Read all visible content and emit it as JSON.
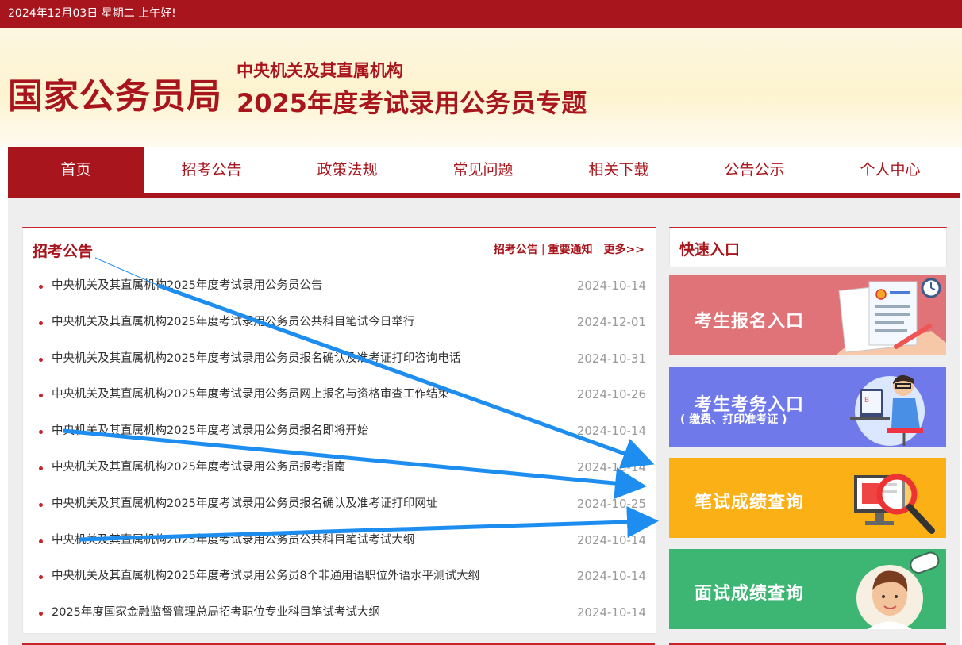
{
  "topbar": {
    "date_greeting": "2024年12月03日  星期二  上午好!"
  },
  "header": {
    "site_name": "国家公务员局",
    "subtitle_line1": "中央机关及其直属机构",
    "subtitle_line2": "2025年度考试录用公务员专题"
  },
  "nav": {
    "items": [
      {
        "label": "首页",
        "active": true
      },
      {
        "label": "招考公告"
      },
      {
        "label": "政策法规"
      },
      {
        "label": "常见问题"
      },
      {
        "label": "相关下载"
      },
      {
        "label": "公告公示"
      },
      {
        "label": "个人中心"
      }
    ]
  },
  "announcements": {
    "title": "招考公告",
    "link_announcements": "招考公告",
    "separator": "|",
    "link_notices": "重要通知",
    "more": "更多>>",
    "items": [
      {
        "title": "中央机关及其直属机构2025年度考试录用公务员公告",
        "date": "2024-10-14"
      },
      {
        "title": "中央机关及其直属机构2025年度考试录用公务员公共科目笔试今日举行",
        "date": "2024-12-01"
      },
      {
        "title": "中央机关及其直属机构2025年度考试录用公务员报名确认及准考证打印咨询电话",
        "date": "2024-10-31"
      },
      {
        "title": "中央机关及其直属机构2025年度考试录用公务员网上报名与资格审查工作结束",
        "date": "2024-10-26"
      },
      {
        "title": "中央机关及其直属机构2025年度考试录用公务员报名即将开始",
        "date": "2024-10-14"
      },
      {
        "title": "中央机关及其直属机构2025年度考试录用公务员报考指南",
        "date": "2024-10-14"
      },
      {
        "title": "中央机关及其直属机构2025年度考试录用公务员报名确认及准考证打印网址",
        "date": "2024-10-25"
      },
      {
        "title": "中央机关及其直属机构2025年度考试录用公务员公共科目笔试考试大纲",
        "date": "2024-10-14"
      },
      {
        "title": "中央机关及其直属机构2025年度考试录用公务员8个非通用语职位外语水平测试大纲",
        "date": "2024-10-14"
      },
      {
        "title": "2025年度国家金融监督管理总局招考职位专业科目笔试考试大纲",
        "date": "2024-10-14"
      }
    ]
  },
  "quick_entry": {
    "title": "快速入口",
    "cards": [
      {
        "label": "考生报名入口",
        "color": "#e07378",
        "icon": "registration-form-icon"
      },
      {
        "label": "考生考务入口",
        "sub": "( 缴费、打印准考证 )",
        "color": "#6f79ea",
        "icon": "student-at-computer-icon"
      },
      {
        "label": "笔试成绩查询",
        "color": "#fbb016",
        "icon": "magnifier-monitor-icon"
      },
      {
        "label": "面试成绩查询",
        "color": "#3db674",
        "icon": "interview-person-icon"
      }
    ]
  },
  "colors": {
    "brand_red": "#a9151c",
    "arrow_blue": "#1d8ef0"
  }
}
